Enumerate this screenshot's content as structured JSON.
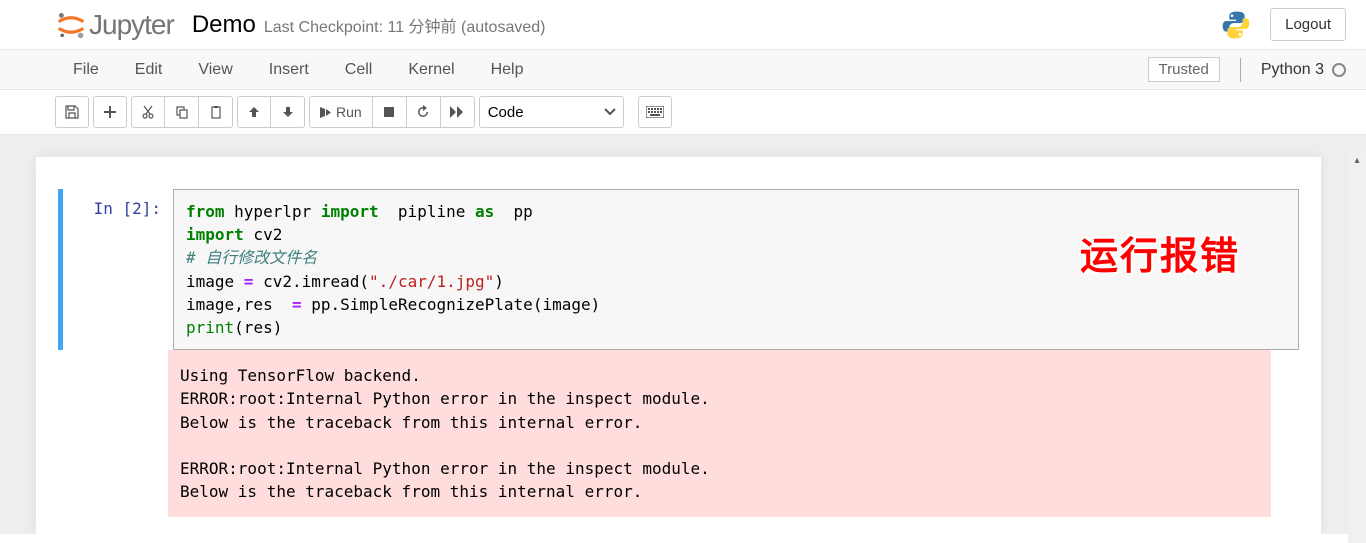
{
  "header": {
    "logo_text": "Jupyter",
    "notebook_title": "Demo",
    "checkpoint_text": "Last Checkpoint: 11 分钟前   (autosaved)",
    "logout_label": "Logout"
  },
  "menubar": {
    "items": [
      "File",
      "Edit",
      "View",
      "Insert",
      "Cell",
      "Kernel",
      "Help"
    ],
    "trusted_label": "Trusted",
    "kernel_name": "Python 3"
  },
  "toolbar": {
    "run_label": "Run",
    "cell_type": "Code"
  },
  "cell": {
    "prompt": "In [2]:",
    "code_tokens": [
      {
        "t": "from",
        "c": "kw"
      },
      {
        "t": " hyperlpr ",
        "c": "cm-var"
      },
      {
        "t": "import",
        "c": "kw"
      },
      {
        "t": "  pipline ",
        "c": "cm-var"
      },
      {
        "t": "as",
        "c": "kw"
      },
      {
        "t": "  pp",
        "c": "cm-var"
      },
      {
        "t": "\n"
      },
      {
        "t": "import",
        "c": "kw"
      },
      {
        "t": " cv2",
        "c": "cm-var"
      },
      {
        "t": "\n"
      },
      {
        "t": "# 自行修改文件名",
        "c": "cm-comment"
      },
      {
        "t": "\n"
      },
      {
        "t": "image ",
        "c": "cm-var"
      },
      {
        "t": "=",
        "c": "cm-op"
      },
      {
        "t": " cv2",
        "c": "cm-var"
      },
      {
        "t": ".",
        "c": "cm-var"
      },
      {
        "t": "imread(",
        "c": "cm-var"
      },
      {
        "t": "\"./car/1.jpg\"",
        "c": "cm-str"
      },
      {
        "t": ")",
        "c": "cm-var"
      },
      {
        "t": "\n"
      },
      {
        "t": "image,res  ",
        "c": "cm-var"
      },
      {
        "t": "=",
        "c": "cm-op"
      },
      {
        "t": " pp",
        "c": "cm-var"
      },
      {
        "t": ".",
        "c": "cm-var"
      },
      {
        "t": "SimpleRecognizePlate(image)",
        "c": "cm-var"
      },
      {
        "t": "\n"
      },
      {
        "t": "print",
        "c": "cm-builtin"
      },
      {
        "t": "(res)",
        "c": "cm-var"
      }
    ],
    "output": "Using TensorFlow backend.\nERROR:root:Internal Python error in the inspect module.\nBelow is the traceback from this internal error.\n\nERROR:root:Internal Python error in the inspect module.\nBelow is the traceback from this internal error.\n"
  },
  "annotation": "运行报错"
}
